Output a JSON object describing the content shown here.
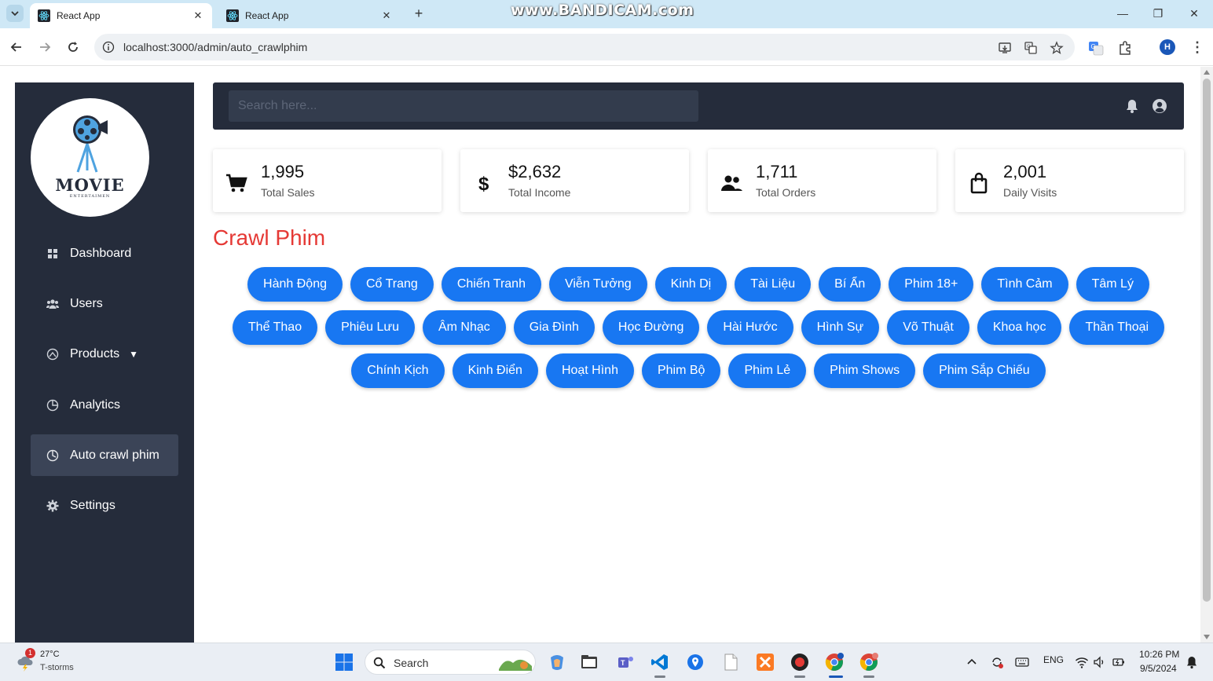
{
  "browser": {
    "tabs": [
      {
        "title": "React App",
        "active": true
      },
      {
        "title": "React App",
        "active": false
      }
    ],
    "new_tab": "+",
    "watermark": "www.BANDICAM.com",
    "url": "localhost:3000/admin/auto_crawlphim",
    "profile_initial": "H"
  },
  "sidebar": {
    "logo": {
      "title": "MOVIE",
      "subtitle": "ENTERTAIMEN"
    },
    "items": [
      {
        "label": "Dashboard",
        "icon": "grid-icon",
        "active": false
      },
      {
        "label": "Users",
        "icon": "users-icon",
        "active": false
      },
      {
        "label": "Products",
        "icon": "products-icon",
        "active": false,
        "caret": "▼"
      },
      {
        "label": "Analytics",
        "icon": "pie-icon",
        "active": false
      },
      {
        "label": "Auto crawl phim",
        "icon": "clock-icon",
        "active": true
      },
      {
        "label": "Settings",
        "icon": "gear-icon",
        "active": false
      }
    ]
  },
  "topbar": {
    "search_placeholder": "Search here..."
  },
  "stats": [
    {
      "value": "1,995",
      "label": "Total Sales",
      "icon": "cart-icon"
    },
    {
      "value": "$2,632",
      "label": "Total Income",
      "icon": "dollar-icon"
    },
    {
      "value": "1,711",
      "label": "Total Orders",
      "icon": "people-icon"
    },
    {
      "value": "2,001",
      "label": "Daily Visits",
      "icon": "bag-icon"
    }
  ],
  "crawl": {
    "title": "Crawl Phim",
    "genres": [
      "Hành Động",
      "Cổ Trang",
      "Chiến Tranh",
      "Viễn Tưởng",
      "Kinh Dị",
      "Tài Liệu",
      "Bí Ẩn",
      "Phim 18+",
      "Tình Cảm",
      "Tâm Lý",
      "Thể Thao",
      "Phiêu Lưu",
      "Âm Nhạc",
      "Gia Đình",
      "Học Đường",
      "Hài Hước",
      "Hình Sự",
      "Võ Thuật",
      "Khoa học",
      "Thần Thoại",
      "Chính Kịch",
      "Kinh Điển",
      "Hoạt Hình",
      "Phim Bộ",
      "Phim Lẻ",
      "Phim Shows",
      "Phim Sắp Chiếu"
    ]
  },
  "taskbar": {
    "weather_badge": "1",
    "temperature": "27°C",
    "weather": "T-storms",
    "search_label": "Search",
    "tray_language": "ENG",
    "time": "10:26 PM",
    "date": "9/5/2024"
  },
  "colors": {
    "sidebar_bg": "#252c3b",
    "accent_button": "#1877f2",
    "title_red": "#e53935"
  }
}
